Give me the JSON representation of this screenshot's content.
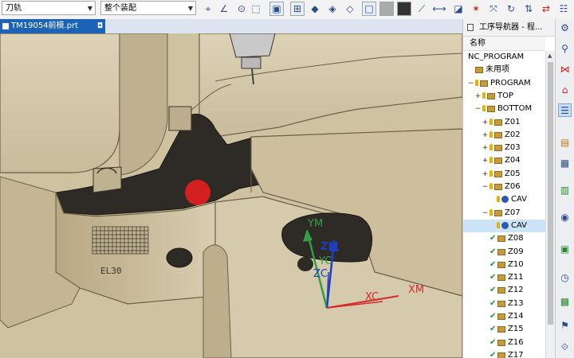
{
  "toolbar": {
    "filter_dropdown": "刀轨",
    "scope_dropdown": "整个装配"
  },
  "document_tab": {
    "title": "TM19054前模.prt"
  },
  "navigator": {
    "title": "工序导航器 - 程...",
    "column_header": "名称",
    "rows": [
      {
        "label": "NC_PROGRAM",
        "level": 0,
        "toggle": "",
        "icon": "none",
        "check": false,
        "selected": false
      },
      {
        "label": "未用项",
        "level": 1,
        "toggle": "",
        "icon": "folder",
        "check": false,
        "selected": false
      },
      {
        "label": "PROGRAM",
        "level": 1,
        "toggle": "−",
        "icon": "key-folder",
        "check": false,
        "selected": false
      },
      {
        "label": "TOP",
        "level": 2,
        "toggle": "+",
        "icon": "key-folder",
        "check": false,
        "selected": false
      },
      {
        "label": "BOTTOM",
        "level": 2,
        "toggle": "−",
        "icon": "key-folder",
        "check": false,
        "selected": false
      },
      {
        "label": "Z01",
        "level": 3,
        "toggle": "+",
        "icon": "key-folder",
        "check": false,
        "selected": false
      },
      {
        "label": "Z02",
        "level": 3,
        "toggle": "+",
        "icon": "key-folder",
        "check": false,
        "selected": false
      },
      {
        "label": "Z03",
        "level": 3,
        "toggle": "+",
        "icon": "key-folder",
        "check": false,
        "selected": false
      },
      {
        "label": "Z04",
        "level": 3,
        "toggle": "+",
        "icon": "key-folder",
        "check": false,
        "selected": false
      },
      {
        "label": "Z05",
        "level": 3,
        "toggle": "+",
        "icon": "key-folder",
        "check": false,
        "selected": false
      },
      {
        "label": "Z06",
        "level": 3,
        "toggle": "−",
        "icon": "key-folder",
        "check": false,
        "selected": false
      },
      {
        "label": "CAV",
        "level": 4,
        "toggle": "",
        "icon": "key-op",
        "check": false,
        "selected": false
      },
      {
        "label": "Z07",
        "level": 3,
        "toggle": "−",
        "icon": "key-folder",
        "check": false,
        "selected": false
      },
      {
        "label": "CAV",
        "level": 4,
        "toggle": "",
        "icon": "key-op",
        "check": false,
        "selected": true
      },
      {
        "label": "Z08",
        "level": 3,
        "toggle": "",
        "icon": "folder",
        "check": true,
        "selected": false
      },
      {
        "label": "Z09",
        "level": 3,
        "toggle": "",
        "icon": "folder",
        "check": true,
        "selected": false
      },
      {
        "label": "Z10",
        "level": 3,
        "toggle": "",
        "icon": "folder",
        "check": true,
        "selected": false
      },
      {
        "label": "Z11",
        "level": 3,
        "toggle": "",
        "icon": "folder",
        "check": true,
        "selected": false
      },
      {
        "label": "Z12",
        "level": 3,
        "toggle": "",
        "icon": "folder",
        "check": true,
        "selected": false
      },
      {
        "label": "Z13",
        "level": 3,
        "toggle": "",
        "icon": "folder",
        "check": true,
        "selected": false
      },
      {
        "label": "Z14",
        "level": 3,
        "toggle": "",
        "icon": "folder",
        "check": true,
        "selected": false
      },
      {
        "label": "Z15",
        "level": 3,
        "toggle": "",
        "icon": "folder",
        "check": true,
        "selected": false
      },
      {
        "label": "Z16",
        "level": 3,
        "toggle": "",
        "icon": "folder",
        "check": true,
        "selected": false
      },
      {
        "label": "Z17",
        "level": 3,
        "toggle": "",
        "icon": "folder",
        "check": true,
        "selected": false
      }
    ]
  },
  "viewport": {
    "axes": {
      "ym": "YM",
      "zm": "ZM",
      "yc": "YC",
      "zc": "ZC",
      "xc": "XC",
      "xm": "XM"
    },
    "engraving": "EL30"
  },
  "colors": {
    "accent": "#1c63b7",
    "model": "#d2c5a6",
    "cavity": "#2e2a25",
    "marker": "#d31f1f",
    "axis_red": "#d62a2a",
    "axis_green": "#2f9e45",
    "axis_blue": "#1f3fc0"
  }
}
